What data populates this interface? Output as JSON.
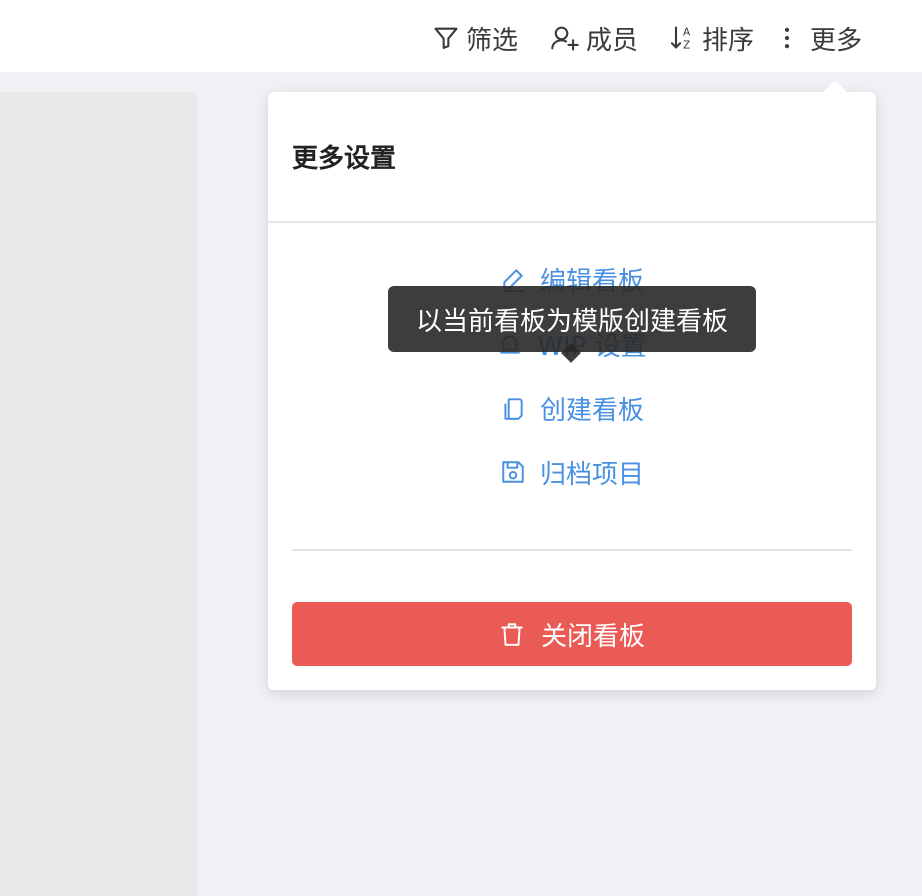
{
  "toolbar": {
    "filter_label": "筛选",
    "members_label": "成员",
    "sort_label": "排序",
    "more_label": "更多"
  },
  "popover": {
    "title": "更多设置",
    "items": [
      {
        "label": "编辑看板",
        "icon": "edit-icon"
      },
      {
        "label": "WIP 设置",
        "icon": "bell-icon"
      },
      {
        "label": "创建看板",
        "icon": "copy-icon"
      },
      {
        "label": "归档项目",
        "icon": "save-icon"
      }
    ],
    "close_label": "关闭看板"
  },
  "tooltip": {
    "text": "以当前看板为模版创建看板"
  },
  "colors": {
    "accent": "#4a90e2",
    "danger": "#ea5b56",
    "background": "#f0f1f5"
  }
}
